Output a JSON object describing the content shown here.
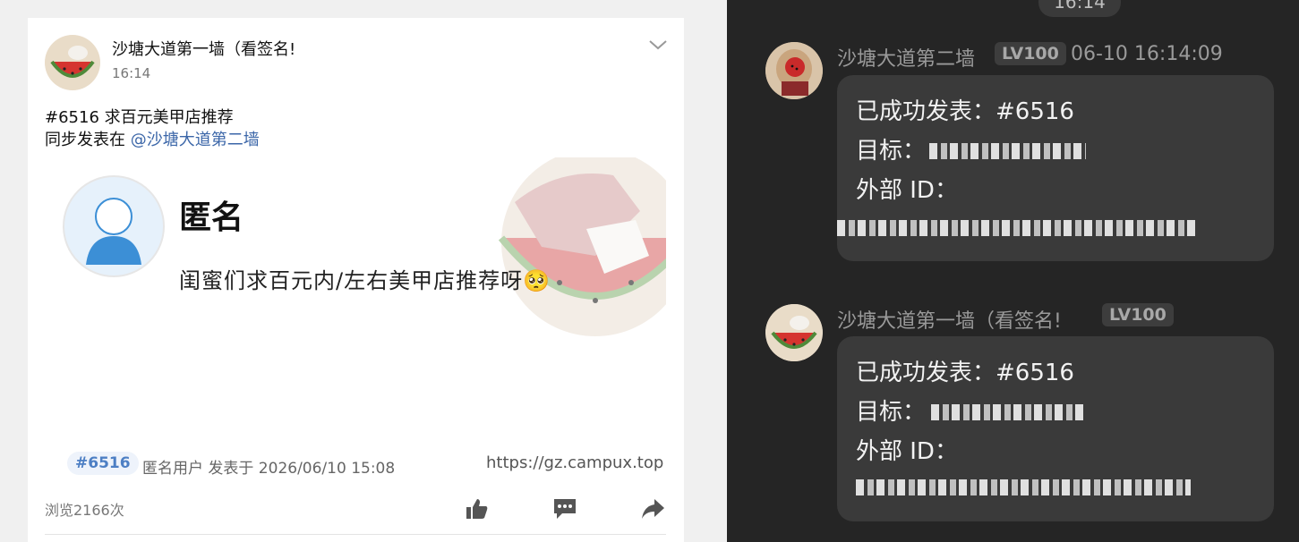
{
  "left_post": {
    "author": "沙塘大道第一墙（看签名!",
    "time": "16:14",
    "line1": "#6516 求百元美甲店推荐",
    "line2_prefix": "同步发表在 ",
    "line2_mention": "@沙塘大道第二墙",
    "image": {
      "anon_name": "匿名",
      "anon_text": "闺蜜们求百元内/左右美甲店推荐呀🥺",
      "tag": "#6516",
      "user_meta": "匿名用户 发表于 2026/06/10 15:08",
      "url": "https://gz.campux.top"
    },
    "views": "浏览2166次",
    "icons": [
      "chevron-down-icon",
      "thumbs-up-icon",
      "comment-icon",
      "share-icon"
    ]
  },
  "chat": {
    "time_pill": "16:14",
    "messages": [
      {
        "sender": "沙塘大道第二墙",
        "level": "LV100",
        "timestamp": "06-10 16:14:09",
        "line1": "已成功发表：#6516",
        "line2_label": "目标：",
        "line3_label": "外部 ID："
      },
      {
        "sender": "沙塘大道第一墙（看签名!",
        "level": "LV100",
        "timestamp": "",
        "line1": "已成功发表：#6516",
        "line2_label": "目标：",
        "line3_label": "外部 ID："
      }
    ]
  },
  "colors": {
    "mention": "#3b66a8",
    "tag_text": "#4d7fc4",
    "chat_bg": "#252525",
    "bubble_bg": "#3a3a3a"
  }
}
